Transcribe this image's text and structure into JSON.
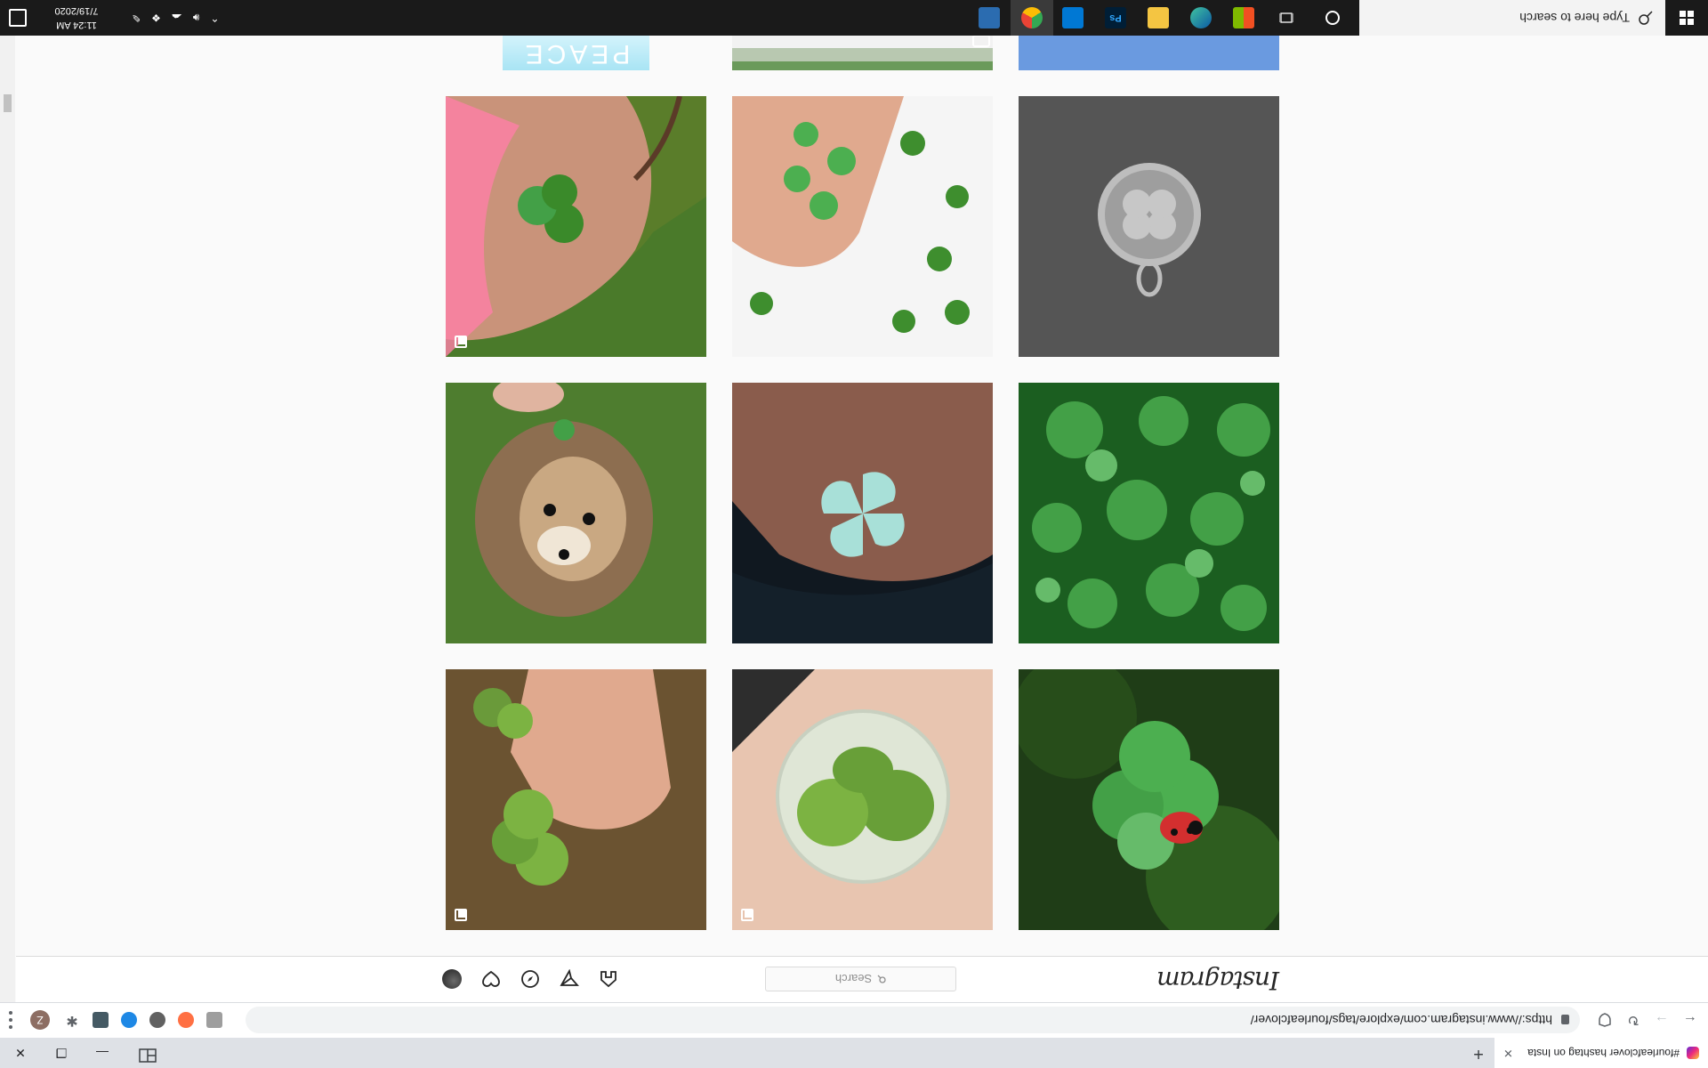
{
  "browser": {
    "tab_title": "#fourleafclover hashtag on Insta",
    "url": "https://www.instagram.com/explore/tags/fourleafclover/",
    "profile_initial": "Z"
  },
  "instagram": {
    "logo": "Instagram",
    "search_placeholder": "Search",
    "nav": [
      "home-icon",
      "direct-icon",
      "explore-icon",
      "activity-icon",
      "profile-avatar"
    ]
  },
  "grid": {
    "tiles": [
      {
        "subject": "ladybug-on-clover",
        "colors": [
          "#1f3d17",
          "#4caf50",
          "#1b5e20"
        ],
        "badge": "none"
      },
      {
        "subject": "clover-in-resin",
        "colors": [
          "#2d2d2d",
          "#e8d5c4",
          "#8bc34a"
        ],
        "badge": "multi"
      },
      {
        "subject": "hand-holding-clovers",
        "colors": [
          "#6b5331",
          "#e0a98e",
          "#7cb342"
        ],
        "badge": "multi"
      },
      {
        "subject": "clover-patch",
        "colors": [
          "#1b5e20",
          "#43a047",
          "#2e7d32"
        ],
        "badge": "none"
      },
      {
        "subject": "origami-clover",
        "colors": [
          "#101820",
          "#b07a63",
          "#a8e0d8"
        ],
        "badge": "none"
      },
      {
        "subject": "dog-with-clover",
        "colors": [
          "#4e7d2f",
          "#8d6e50",
          "#2e5d1f"
        ],
        "badge": "none"
      },
      {
        "subject": "clover-pendant",
        "colors": [
          "#4a4a4a",
          "#5c5c5c",
          "#c0c0c0"
        ],
        "badge": "none"
      },
      {
        "subject": "clovers-in-box",
        "colors": [
          "#ffffff",
          "#3e8e2e",
          "#e0a98e"
        ],
        "badge": "none"
      },
      {
        "subject": "clover-tattoo",
        "colors": [
          "#5a7d2a",
          "#c9937a",
          "#ff6b9a"
        ],
        "badge": "multi"
      },
      {
        "subject": "sky",
        "colors": [
          "#6a9ae0",
          "#5a8ad0",
          "#7aa8e8"
        ],
        "badge": "none"
      },
      {
        "subject": "grass",
        "colors": [
          "#ffffff",
          "#6a9a5a",
          "#d0d0d0"
        ],
        "badge": "camera"
      },
      {
        "subject": "peace-sign",
        "colors": [
          "#a8e4f4",
          "#ccf0f8",
          "#e8fafe"
        ],
        "badge": "none",
        "caption": "PEACE"
      }
    ]
  },
  "taskbar": {
    "search_placeholder": "Type here to search",
    "time": "11:24 AM",
    "date": "7/19/2020",
    "apps": [
      "cortana-icon",
      "task-view-icon",
      "store-icon",
      "edge-icon",
      "file-explorer-icon",
      "photoshop-icon",
      "onedrive-icon",
      "chrome-icon",
      "remote-desktop-icon"
    ]
  }
}
